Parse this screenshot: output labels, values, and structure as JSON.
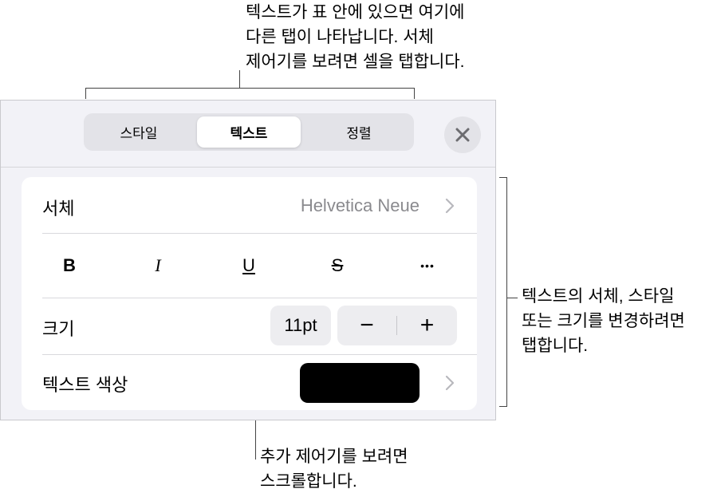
{
  "callouts": {
    "top": [
      "텍스트가 표 안에 있으면 여기에",
      "다른 탭이 나타납니다. 서체",
      "제어기를 보려면 셀을 탭합니다."
    ],
    "right": [
      "텍스트의 서체, 스타일",
      "또는 크기를 변경하려면",
      "탭합니다."
    ],
    "bottom": [
      "추가 제어기를 보려면",
      "스크롤합니다."
    ]
  },
  "tabs": [
    {
      "label": "스타일",
      "active": false
    },
    {
      "label": "텍스트",
      "active": true
    },
    {
      "label": "정렬",
      "active": false
    }
  ],
  "close_icon": "close-icon",
  "font_row": {
    "label": "서체",
    "value": "Helvetica Neue",
    "icon": "chevron-right-icon"
  },
  "style_buttons": {
    "bold": "B",
    "italic": "I",
    "underline": "U",
    "strikethrough": "S",
    "more": "•••"
  },
  "size_row": {
    "label": "크기",
    "value": "11pt",
    "decrement": "−",
    "increment": "+"
  },
  "color_row": {
    "label": "텍스트 색상",
    "swatch_color": "#000000",
    "icon": "chevron-right-icon"
  },
  "colors": {
    "panel_bg": "#f2f2f7",
    "card_bg": "#ffffff",
    "secondary_text": "#8a8a8e"
  }
}
